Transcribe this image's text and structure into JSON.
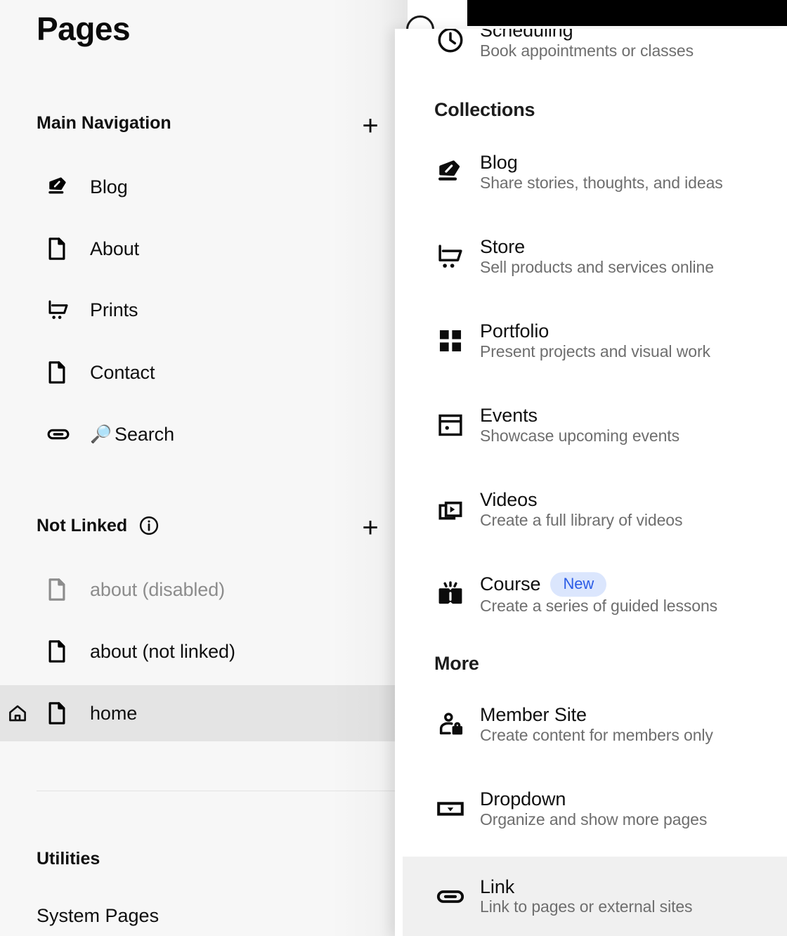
{
  "sidebar": {
    "title": "Pages",
    "sections": [
      {
        "heading": "Main Navigation",
        "add_label": "+",
        "items": [
          {
            "label": "Blog",
            "icon": "pen-nib-icon",
            "state": "normal"
          },
          {
            "label": "About",
            "icon": "page-icon",
            "state": "normal"
          },
          {
            "label": "Prints",
            "icon": "cart-icon",
            "state": "normal"
          },
          {
            "label": "Contact",
            "icon": "page-icon",
            "state": "normal"
          },
          {
            "label": "Search",
            "icon": "link-icon",
            "emoji": "🔎",
            "state": "normal"
          }
        ]
      },
      {
        "heading": "Not Linked",
        "info_icon": "info-icon",
        "add_label": "+",
        "items": [
          {
            "label": "about (disabled)",
            "icon": "page-icon",
            "state": "disabled"
          },
          {
            "label": "about (not linked)",
            "icon": "page-icon",
            "state": "normal"
          },
          {
            "label": "home",
            "icon": "page-icon",
            "state": "selected",
            "home_icon": "home-icon"
          }
        ]
      }
    ],
    "utilities": {
      "heading": "Utilities",
      "items": [
        {
          "label": "System Pages"
        }
      ]
    }
  },
  "panel": {
    "groups": [
      {
        "heading": "",
        "options": [
          {
            "title": "Scheduling",
            "desc": "Book appointments or classes",
            "icon": "clock-icon",
            "state": "clipped"
          }
        ]
      },
      {
        "heading": "Collections",
        "options": [
          {
            "title": "Blog",
            "desc": "Share stories, thoughts, and ideas",
            "icon": "pen-nib-icon",
            "state": "normal"
          },
          {
            "title": "Store",
            "desc": "Sell products and services online",
            "icon": "cart-icon",
            "state": "normal"
          },
          {
            "title": "Portfolio",
            "desc": "Present projects and visual work",
            "icon": "grid-icon",
            "state": "normal"
          },
          {
            "title": "Events",
            "desc": "Showcase upcoming events",
            "icon": "calendar-icon",
            "state": "normal"
          },
          {
            "title": "Videos",
            "desc": "Create a full library of videos",
            "icon": "video-icon",
            "state": "normal"
          },
          {
            "title": "Course",
            "desc": "Create a series of guided lessons",
            "icon": "book-icon",
            "state": "normal",
            "badge": "New"
          }
        ]
      },
      {
        "heading": "More",
        "options": [
          {
            "title": "Member Site",
            "desc": "Create content for members only",
            "icon": "member-lock-icon",
            "state": "normal"
          },
          {
            "title": "Dropdown",
            "desc": "Organize and show more pages",
            "icon": "dropdown-icon",
            "state": "normal"
          },
          {
            "title": "Link",
            "desc": "Link to pages or external sites",
            "icon": "link-icon",
            "state": "selected"
          }
        ]
      }
    ]
  },
  "colors": {
    "sidebar_bg": "#f7f7f7",
    "panel_bg": "#ffffff",
    "selected_row": "#e4e4e4",
    "panel_selected_row": "#f0f0f0",
    "badge_bg": "#dbe6fd",
    "badge_text": "#2b5ce6",
    "muted_text": "#6e6e6e",
    "disabled_text": "#8c8c8c",
    "top_bar": "#000000"
  }
}
